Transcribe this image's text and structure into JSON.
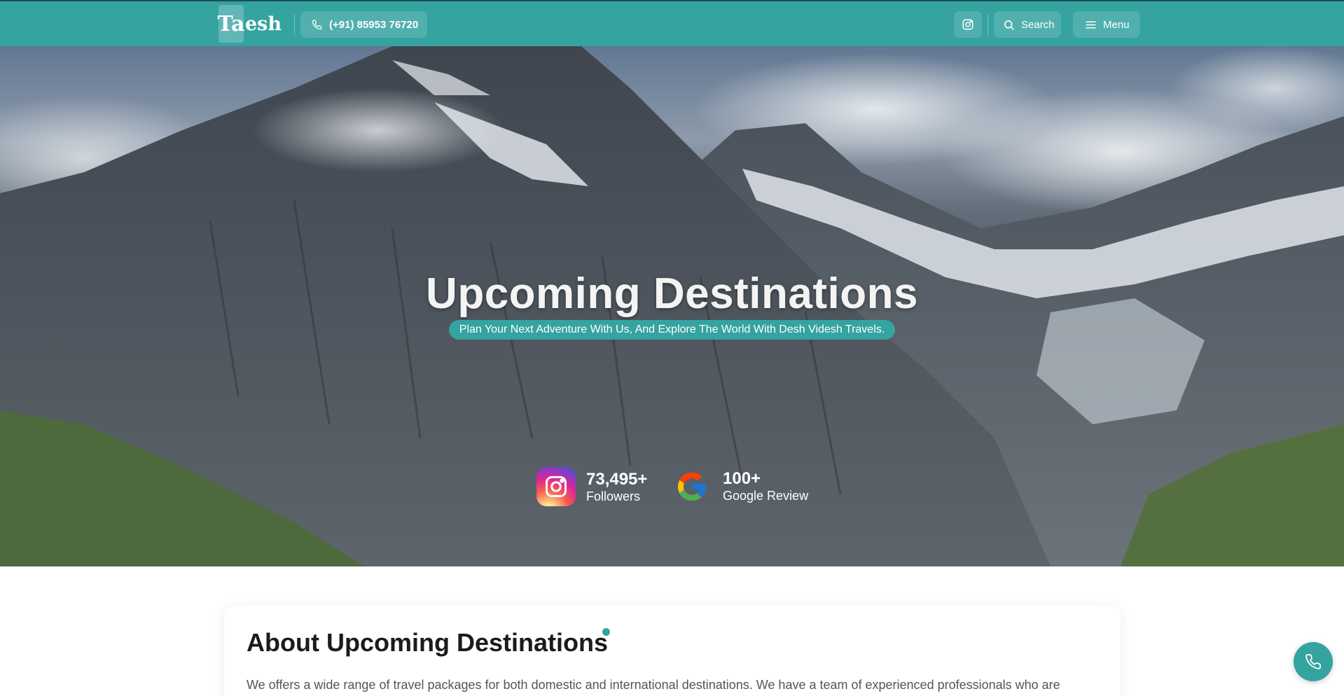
{
  "header": {
    "logo_mark": "Ta",
    "logo_text": "esh",
    "phone": "(+91) 85953 76720",
    "search_label": "Search",
    "menu_label": "Menu"
  },
  "hero": {
    "title": "Upcoming Destinations",
    "subtitle": "Plan Your Next Adventure With Us, And Explore The World With Desh Videsh Travels.",
    "stats": {
      "instagram": {
        "value": "73,495+",
        "label": "Followers"
      },
      "google": {
        "value": "100+",
        "label": "Google Review"
      }
    }
  },
  "about": {
    "title": "About Upcoming Destinations",
    "text": "We offers a wide range of travel packages for both domestic and international destinations. We have a team of experienced professionals who are"
  },
  "colors": {
    "accent": "#35a3a0",
    "header_border": "#1d4f52"
  },
  "icons": {
    "phone": "phone-icon",
    "instagram": "instagram-icon",
    "search": "search-icon",
    "menu": "menu-icon",
    "google": "google-icon",
    "call_fab": "phone-icon"
  }
}
